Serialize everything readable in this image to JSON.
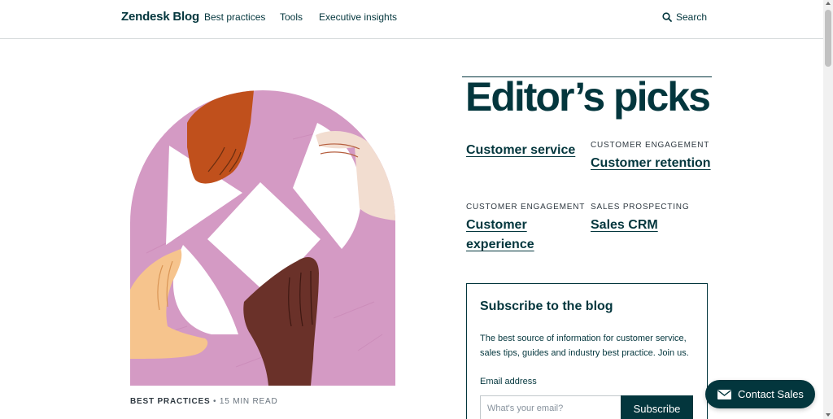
{
  "header": {
    "brand": "Zendesk Blog",
    "nav": [
      "Best practices",
      "Tools",
      "Executive insights"
    ],
    "search_label": "Search"
  },
  "hero": {
    "category": "BEST PRACTICES",
    "separator": " • ",
    "read_time": "15 MIN READ"
  },
  "picks": {
    "title": "Editor’s picks",
    "items": [
      {
        "category": "",
        "title": "Customer service"
      },
      {
        "category": "CUSTOMER ENGAGEMENT",
        "title": "Customer retention"
      },
      {
        "category": "CUSTOMER ENGAGEMENT",
        "title": "Customer experience"
      },
      {
        "category": "SALES PROSPECTING",
        "title": "Sales CRM"
      }
    ]
  },
  "subscribe": {
    "title": "Subscribe to the blog",
    "description": "The best source of information for customer service, sales tips, guides and industry best practice. Join us.",
    "email_label": "Email address",
    "email_placeholder": "What's your email?",
    "button": "Subscribe"
  },
  "contact": {
    "label": "Contact Sales"
  },
  "colors": {
    "brand": "#03363d",
    "art_background": "#d49ac4"
  },
  "icons": [
    "search-icon",
    "mail-icon"
  ]
}
